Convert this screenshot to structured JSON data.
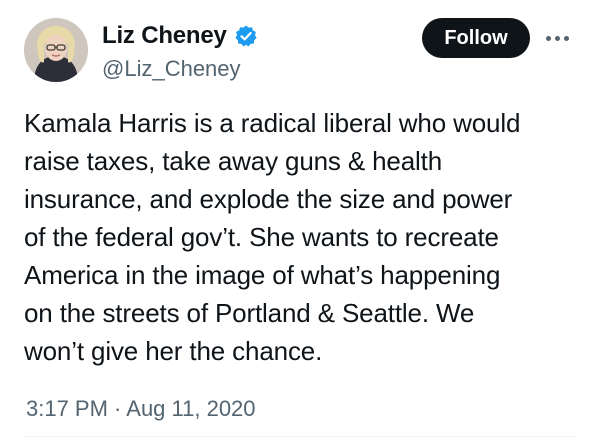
{
  "author": {
    "display_name": "Liz Cheney",
    "handle": "@Liz_Cheney",
    "verified_icon": "verified-badge-icon",
    "verified_color": "#1d9bf0"
  },
  "actions": {
    "follow_label": "Follow",
    "more_icon": "more-options-icon"
  },
  "tweet": {
    "text": "Kamala Harris is a radical liberal who would\nraise taxes, take away guns & health\ninsurance, and explode the size and power\nof the federal gov’t. She wants to recreate\nAmerica in the image of what’s happening\non the streets of Portland & Seattle. We\nwon’t give her the chance.",
    "timestamp": "3:17 PM · Aug 11, 2020"
  },
  "colors": {
    "text_primary": "#0f1419",
    "text_secondary": "#536471",
    "button_bg": "#0f1419",
    "button_text": "#ffffff"
  }
}
